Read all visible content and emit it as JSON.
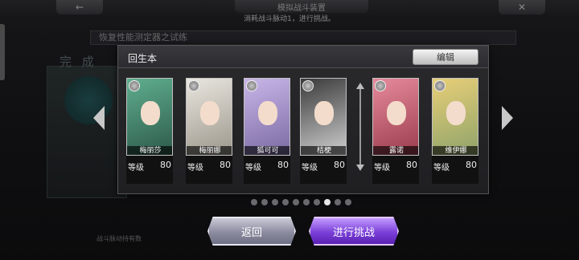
{
  "header": {
    "title": "模拟战斗装置",
    "hint": "消耗战斗脉动1，进行挑战。"
  },
  "background": {
    "stage_title": "恢复性能测定器之试练",
    "complete_text": "完 成",
    "bottom_text": "战斗脉动持有数"
  },
  "dialog": {
    "title": "回生本",
    "edit_label": "编辑",
    "level_label": "等级",
    "team": [
      {
        "name": "梅丽莎",
        "level": "80",
        "palette": [
          "#5fae8f",
          "#2d5a4a"
        ]
      },
      {
        "name": "梅丽娜",
        "level": "80",
        "palette": [
          "#e9e6df",
          "#9d978c"
        ]
      },
      {
        "name": "狐可可",
        "level": "80",
        "palette": [
          "#c9b6e8",
          "#7a6aa3"
        ]
      },
      {
        "name": "桔梗",
        "level": "80",
        "palette": [
          "#3a3a3a",
          "#cfcfcf"
        ]
      },
      {
        "name": "露诺",
        "level": "80",
        "palette": [
          "#e58a9c",
          "#9c3c4e"
        ]
      },
      {
        "name": "维伊娜",
        "level": "80",
        "palette": [
          "#e8cf78",
          "#8fa36a"
        ]
      }
    ]
  },
  "pagination": {
    "count": 10,
    "active_index": 7
  },
  "buttons": {
    "back_label": "返回",
    "challenge_label": "进行挑战"
  },
  "colors": {
    "challenge_accent": "#8a4ae6",
    "back_accent": "#9a9ab0"
  }
}
